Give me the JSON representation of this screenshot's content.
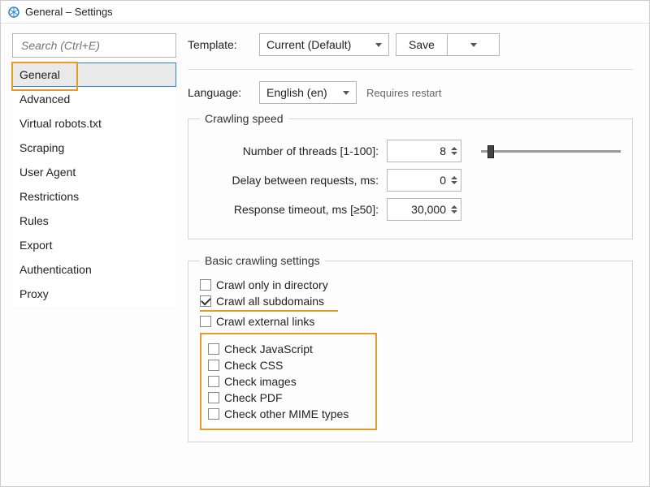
{
  "window": {
    "title": "General – Settings"
  },
  "sidebar": {
    "search_placeholder": "Search (Ctrl+E)",
    "items": [
      {
        "label": "General",
        "selected": true
      },
      {
        "label": "Advanced"
      },
      {
        "label": "Virtual robots.txt"
      },
      {
        "label": "Scraping"
      },
      {
        "label": "User Agent"
      },
      {
        "label": "Restrictions"
      },
      {
        "label": "Rules"
      },
      {
        "label": "Export"
      },
      {
        "label": "Authentication"
      },
      {
        "label": "Proxy"
      }
    ]
  },
  "template": {
    "label": "Template:",
    "value": "Current (Default)",
    "save": "Save"
  },
  "language": {
    "label": "Language:",
    "value": "English (en)",
    "hint": "Requires restart"
  },
  "crawling_speed": {
    "legend": "Crawling speed",
    "threads_label": "Number of threads [1-100]:",
    "threads_value": "8",
    "delay_label": "Delay between requests, ms:",
    "delay_value": "0",
    "timeout_label": "Response timeout, ms [≥50]:",
    "timeout_value": "30,000"
  },
  "basic": {
    "legend": "Basic crawling settings",
    "crawl_dir": "Crawl only in directory",
    "crawl_sub": "Crawl all subdomains",
    "crawl_ext": "Crawl external links",
    "check_js": "Check JavaScript",
    "check_css": "Check CSS",
    "check_img": "Check images",
    "check_pdf": "Check PDF",
    "check_mime": "Check other MIME types"
  }
}
